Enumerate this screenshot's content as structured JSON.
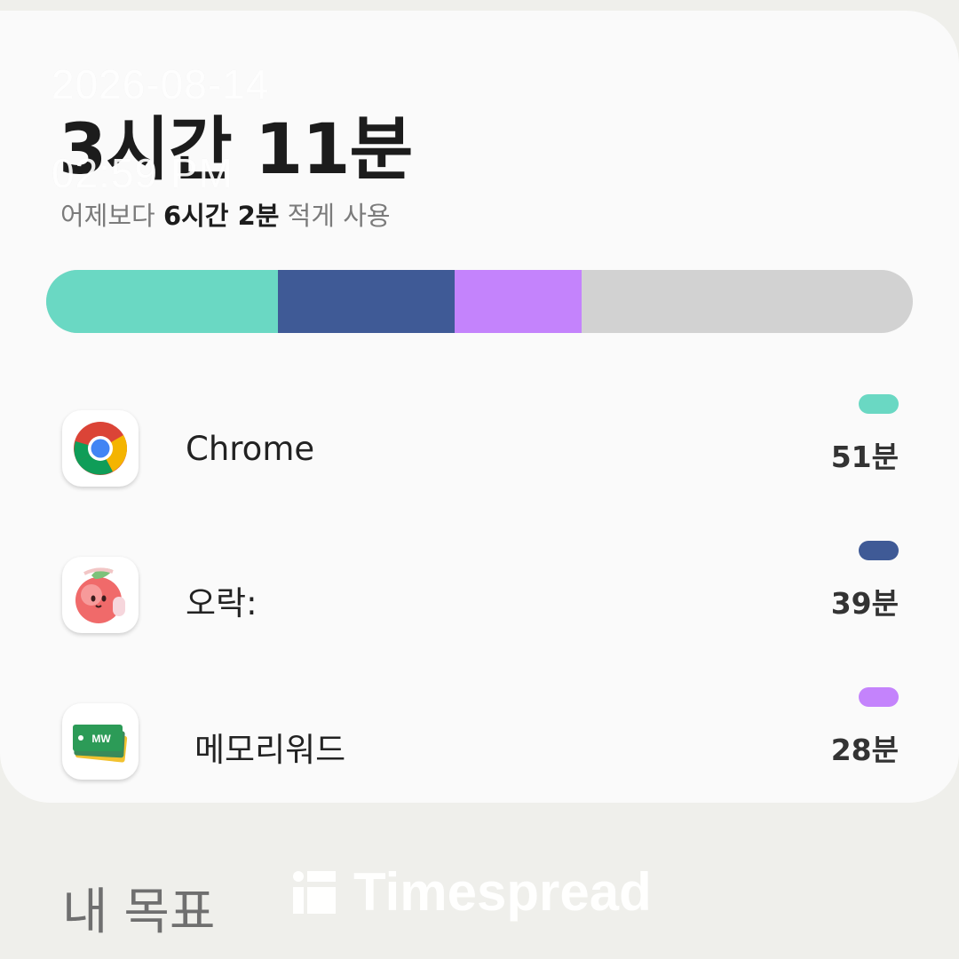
{
  "overlay": {
    "date": "2026-08-14",
    "time": "02:59 PM"
  },
  "summary": {
    "total_time": "3시간 11분",
    "compare_prefix": "어제보다 ",
    "compare_amount": "6시간 2분",
    "compare_suffix": " 적게 사용"
  },
  "usage_bar": {
    "segments": [
      {
        "app": "Chrome",
        "minutes": 51,
        "color": "#6ad8c3"
      },
      {
        "app": "오락:",
        "minutes": 39,
        "color": "#3f5a96"
      },
      {
        "app": "메모리워드",
        "minutes": 28,
        "color": "#c483fc"
      }
    ],
    "remaining_color": "#d2d2d2"
  },
  "apps": [
    {
      "name": "Chrome",
      "time": "51분",
      "icon": "chrome-icon",
      "chip_color": "#6ad8c3"
    },
    {
      "name": "오락:",
      "time": "39분",
      "icon": "peach-character-icon",
      "chip_color": "#3f5a96"
    },
    {
      "name": "메모리워드",
      "time": "28분",
      "icon": "memoryword-icon",
      "chip_color": "#c483fc"
    }
  ],
  "goals": {
    "title": "내 목표"
  },
  "watermark": {
    "text": "Timespread"
  }
}
